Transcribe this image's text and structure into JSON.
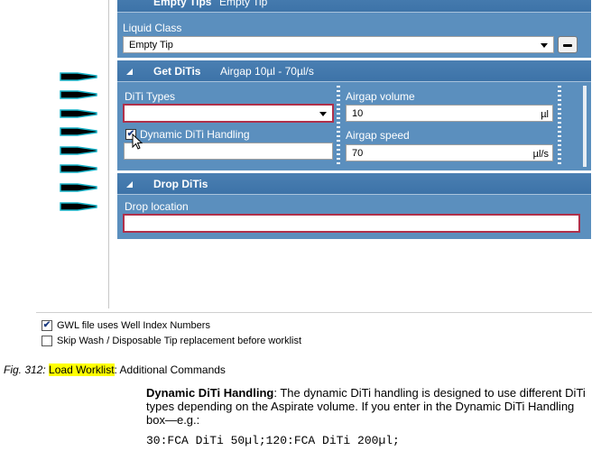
{
  "empty_tips": {
    "title": "Empty Tips",
    "subtitle": "Empty Tip",
    "liquid_class_label": "Liquid Class",
    "liquid_class_value": "Empty Tip"
  },
  "get_ditis": {
    "title": "Get DiTis",
    "subtitle": "Airgap 10µl - 70µl/s",
    "ditis_types_label": "DiTi Types",
    "ditis_types_value": "",
    "dynamic_label": "Dynamic DiTi Handling",
    "dynamic_checked": true,
    "dynamic_value": "",
    "airgap_volume_label": "Airgap volume",
    "airgap_volume_value": "10",
    "airgap_volume_unit": "µl",
    "airgap_speed_label": "Airgap speed",
    "airgap_speed_value": "70",
    "airgap_speed_unit": "µl/s"
  },
  "drop_ditis": {
    "title": "Drop DiTis",
    "drop_location_label": "Drop location",
    "drop_location_value": ""
  },
  "options": {
    "gwl_label": "GWL file uses Well Index Numbers",
    "gwl_checked": true,
    "skip_wash_label": "Skip Wash / Disposable Tip replacement before worklist",
    "skip_wash_checked": false
  },
  "caption": {
    "fig": "Fig. 312:",
    "highlight": "Load Worklist",
    "rest": ": Additional Commands"
  },
  "description": {
    "term": "Dynamic DiTi Handling",
    "text": ": The dynamic DiTi handling is designed to use different DiTi types depending on the Aspirate volume. If you enter in the Dynamic DiTi Handling box—e.g.:",
    "code": "30:FCA DiTi 50µl;120:FCA DiTi 200µl;"
  },
  "colors": {
    "panel": "#5b8fbe",
    "panel_header": "#3d73a8",
    "error_border": "#b0304a",
    "highlight": "#ffff00",
    "tip_icon": "#17b3c8"
  }
}
